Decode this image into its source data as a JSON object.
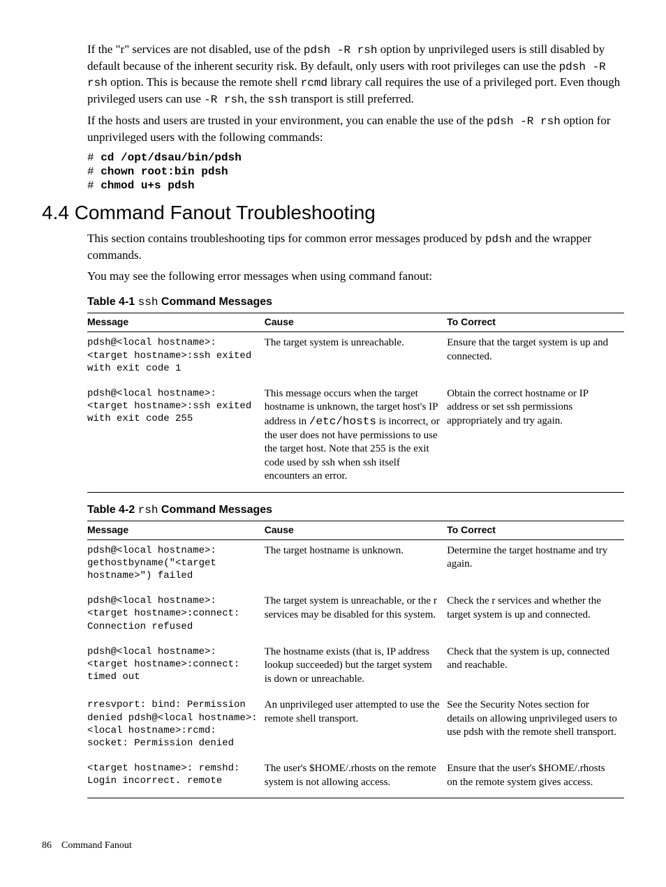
{
  "intro": {
    "p1a": "If the \"r\" services are not disabled, use of the ",
    "p1b": "pdsh -R rsh",
    "p1c": " option by unprivileged users is still disabled by default because of the inherent security risk. By default, only users with root privileges can use the ",
    "p1d": "pdsh -R rsh",
    "p1e": " option. This is because the remote shell ",
    "p1f": "rcmd",
    "p1g": " library call requires the use of a privileged port. Even though privileged users can use ",
    "p1h": "-R rsh",
    "p1i": ", the ",
    "p1j": "ssh",
    "p1k": " transport is still preferred.",
    "p2a": "If the hosts and users are trusted in your environment, you can enable the use of the ",
    "p2b": "pdsh -R rsh",
    "p2c": " option for unprivileged users with the following commands:",
    "cmd1p": "# ",
    "cmd1": "cd /opt/dsau/bin/pdsh",
    "cmd2p": "# ",
    "cmd2": "chown root:bin pdsh",
    "cmd3p": "# ",
    "cmd3": "chmod u+s pdsh"
  },
  "section": {
    "heading": "4.4 Command Fanout Troubleshooting",
    "p1a": "This section contains troubleshooting tips for common error messages produced by ",
    "p1b": "pdsh",
    "p1c": " and the wrapper commands.",
    "p2": "You may see the following error messages when using command fanout:"
  },
  "table1": {
    "title_prefix": "Table 4-1 ",
    "title_mono": "ssh",
    "title_suffix": " Command Messages",
    "headers": [
      "Message",
      "Cause",
      "To Correct"
    ],
    "rows": [
      {
        "msg": "pdsh@<local hostname>: <target hostname>:ssh exited with exit code 1",
        "cause": "The target system is unreachable.",
        "fix": "Ensure that the target system is up and connected."
      },
      {
        "msg": "pdsh@<local hostname>: <target hostname>:ssh exited with exit code 255",
        "cause_a": "This message occurs when the target hostname is unknown, the target host's IP address in ",
        "cause_b": "/etc/hosts",
        "cause_c": " is incorrect, or the user does not have permissions to use the target host. Note that 255 is the exit code used by ssh when ssh itself encounters an error.",
        "fix": "Obtain the correct hostname or IP address or set ssh permissions appropriately and try again."
      }
    ]
  },
  "table2": {
    "title_prefix": "Table 4-2 ",
    "title_mono": "rsh",
    "title_suffix": " Command Messages",
    "headers": [
      "Message",
      "Cause",
      "To Correct"
    ],
    "rows": [
      {
        "msg": "pdsh@<local hostname>: gethostbyname(\"<target hostname>\") failed",
        "cause": "The target hostname is unknown.",
        "fix": "Determine the target hostname and try again."
      },
      {
        "msg": "pdsh@<local hostname>: <target hostname>:connect: Connection refused",
        "cause": "The target system is unreachable, or the r services may be disabled for this system.",
        "fix": "Check the r services and whether the target system is up and connected."
      },
      {
        "msg": "pdsh@<local hostname>: <target hostname>:connect: timed out",
        "cause": "The hostname exists (that is, IP address lookup succeeded) but the target system is down or unreachable.",
        "fix": "Check that the system is up, connected and reachable."
      },
      {
        "msg": "rresvport: bind: Permission denied\npdsh@<local hostname>: <local hostname>:rcmd: socket: Permission denied",
        "cause": "An unprivileged user attempted to use the remote shell transport.",
        "fix": "See the Security Notes section for details on allowing unprivileged users to use pdsh with the remote shell transport."
      },
      {
        "msg": "<target hostname>: remshd: Login incorrect. remote",
        "cause": "The user's $HOME/.rhosts on the remote system is not allowing access.",
        "fix": "Ensure that the user's $HOME/.rhosts on the remote system gives access."
      }
    ]
  },
  "footer": {
    "pagenum": "86",
    "chapter": "Command Fanout"
  }
}
